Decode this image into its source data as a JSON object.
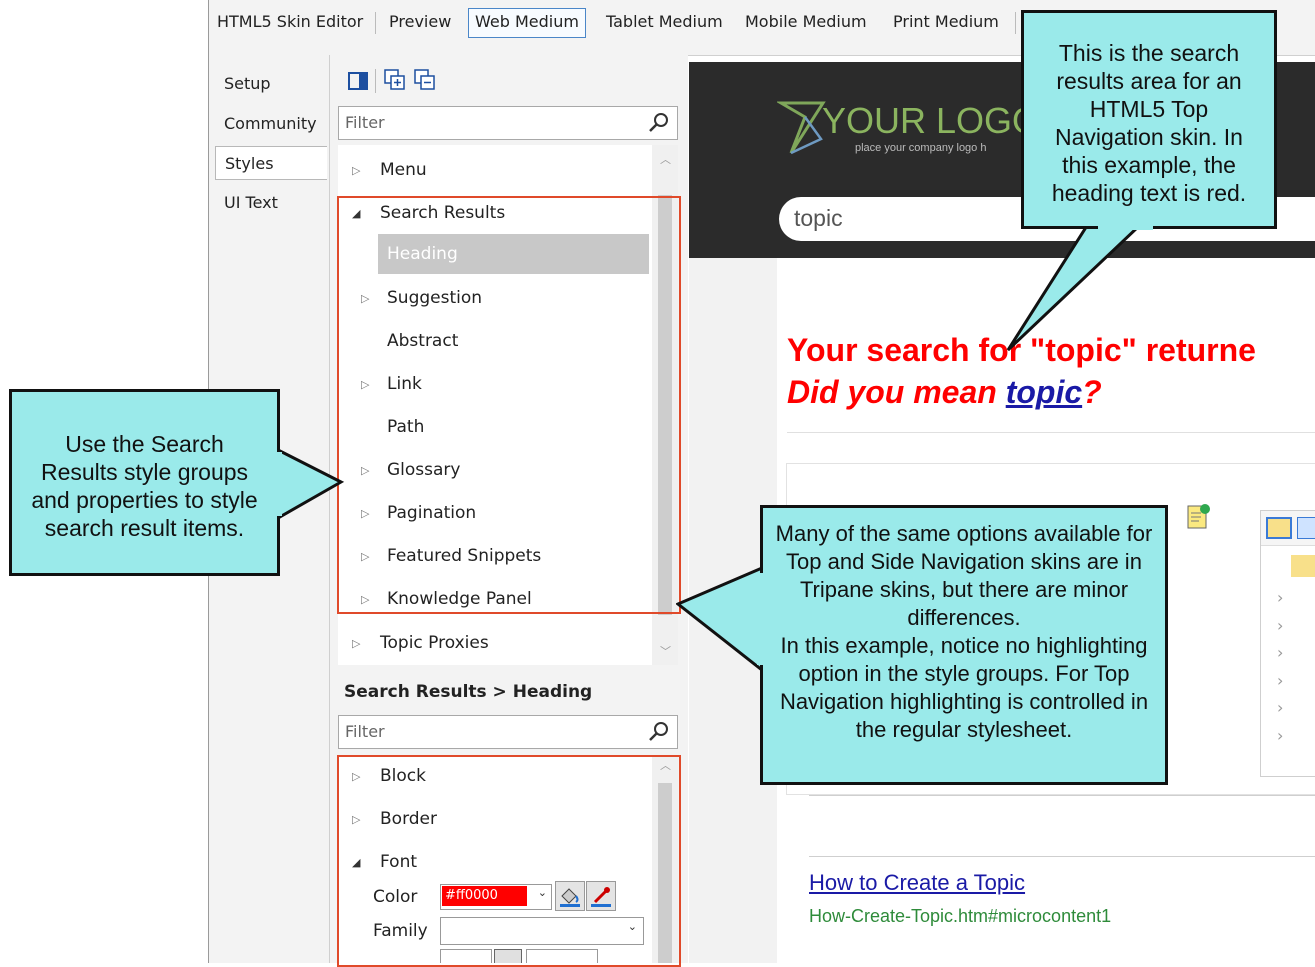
{
  "toolbar": {
    "tabs": [
      "HTML5 Skin Editor",
      "Preview",
      "Web Medium",
      "Tablet Medium",
      "Mobile Medium",
      "Print Medium"
    ],
    "active_tab": "Web Medium"
  },
  "left_nav": {
    "items": [
      "Setup",
      "Community",
      "Styles",
      "UI Text"
    ],
    "active": "Styles"
  },
  "styles_panel": {
    "filter_placeholder": "Filter",
    "tree": [
      {
        "label": "Menu",
        "expanded": false
      },
      {
        "label": "Search Results",
        "expanded": true
      },
      {
        "label": "Heading",
        "selected": true
      },
      {
        "label": "Suggestion",
        "expanded": false
      },
      {
        "label": "Abstract"
      },
      {
        "label": "Link",
        "expanded": false
      },
      {
        "label": "Path"
      },
      {
        "label": "Glossary",
        "expanded": false
      },
      {
        "label": "Pagination",
        "expanded": false
      },
      {
        "label": "Featured Snippets",
        "expanded": false
      },
      {
        "label": "Knowledge Panel",
        "expanded": false
      },
      {
        "label": "Topic Proxies",
        "expanded": false
      }
    ]
  },
  "properties_panel": {
    "title": "Search Results > Heading",
    "filter_placeholder": "Filter",
    "groups": [
      "Block",
      "Border",
      "Font"
    ],
    "color_label": "Color",
    "color_value": "#ff0000",
    "family_label": "Family",
    "family_value": ""
  },
  "preview": {
    "logo_text": "YOUR LOGO",
    "logo_sub": "place your company logo h",
    "search_value": "topic",
    "heading_line1": "Your search for \"topic\" returne",
    "heading_line2_prefix": "Did you mean ",
    "heading_line2_link": "topic",
    "heading_line2_suffix": "?",
    "result_link": "How to Create a Topic",
    "result_path": "How-Create-Topic.htm#microcontent1"
  },
  "callouts": {
    "top_right": "This is the search results area for an HTML5 Top Navigation skin. In this example, the heading text is red.",
    "left": "Use the Search Results style groups and properties to style search result items.",
    "center": "Many of the same options available for Top and Side Navigation skins are in Tripane skins, but there are minor differences.\nIn this example, notice no highlighting option in the style groups. For Top Navigation highlighting is controlled in the regular stylesheet."
  },
  "colors": {
    "callout_fill": "#9aeaea",
    "highlight_box": "#e04a2a",
    "heading_red": "#ff0000",
    "link_blue": "#1a1aa6",
    "path_green": "#2e8b3a",
    "logo_bar": "#2b2b2b"
  }
}
